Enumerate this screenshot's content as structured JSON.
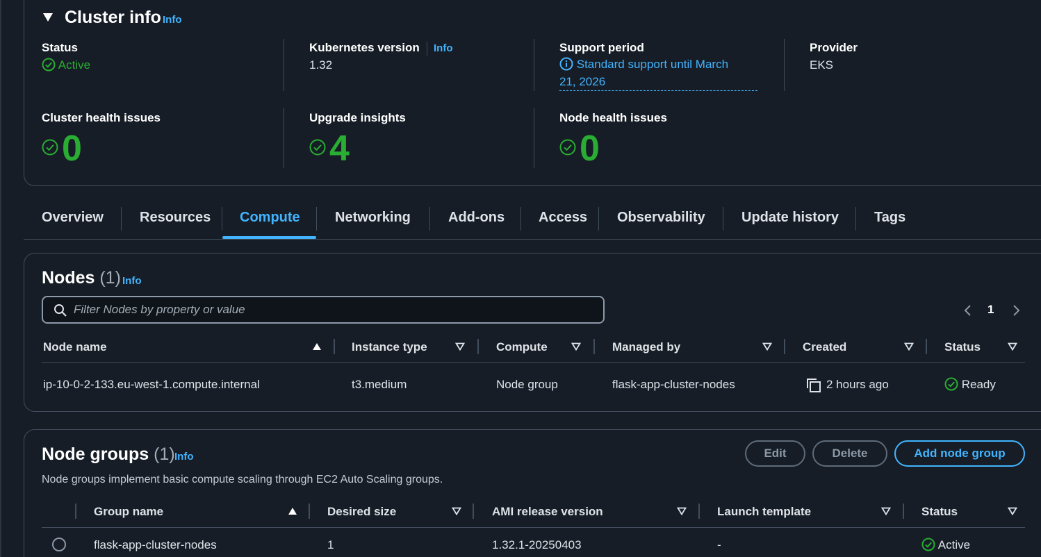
{
  "cluster_info": {
    "title": "Cluster info",
    "info_label": "Info",
    "status": {
      "label": "Status",
      "value": "Active"
    },
    "kubernetes_version": {
      "label": "Kubernetes version",
      "info_label": "Info",
      "value": "1.32"
    },
    "support_period": {
      "label": "Support period",
      "line1": "Standard support until March",
      "line2": "21, 2026"
    },
    "provider": {
      "label": "Provider",
      "value": "EKS"
    },
    "cluster_health_issues": {
      "label": "Cluster health issues",
      "value": "0"
    },
    "upgrade_insights": {
      "label": "Upgrade insights",
      "value": "4"
    },
    "node_health_issues": {
      "label": "Node health issues",
      "value": "0"
    }
  },
  "tabs": [
    {
      "label": "Overview"
    },
    {
      "label": "Resources"
    },
    {
      "label": "Compute"
    },
    {
      "label": "Networking"
    },
    {
      "label": "Add-ons"
    },
    {
      "label": "Access"
    },
    {
      "label": "Observability"
    },
    {
      "label": "Update history"
    },
    {
      "label": "Tags"
    }
  ],
  "active_tab": "Compute",
  "nodes": {
    "title": "Nodes",
    "count": "(1)",
    "info_label": "Info",
    "search_placeholder": "Filter Nodes by property or value",
    "page": "1",
    "columns": [
      "Node name",
      "Instance type",
      "Compute",
      "Managed by",
      "Created",
      "Status"
    ],
    "rows": [
      {
        "node_name": "ip-10-0-2-133.eu-west-1.compute.internal",
        "instance_type": "t3.medium",
        "compute": "Node group",
        "managed_by": "flask-app-cluster-nodes",
        "created": "2 hours ago",
        "status": "Ready"
      }
    ]
  },
  "node_groups": {
    "title": "Node groups",
    "count": "(1)",
    "info_label": "Info",
    "description": "Node groups implement basic compute scaling through EC2 Auto Scaling groups.",
    "edit_label": "Edit",
    "delete_label": "Delete",
    "add_label": "Add node group",
    "columns": [
      "Group name",
      "Desired size",
      "AMI release version",
      "Launch template",
      "Status"
    ],
    "rows": [
      {
        "group_name": "flask-app-cluster-nodes",
        "desired_size": "1",
        "ami_release_version": "1.32.1-20250403",
        "launch_template": "-",
        "status": "Active"
      }
    ]
  },
  "colors": {
    "background": "#161d26",
    "link": "#42b4ff",
    "success": "#29ad32",
    "border": "#414d5c"
  }
}
